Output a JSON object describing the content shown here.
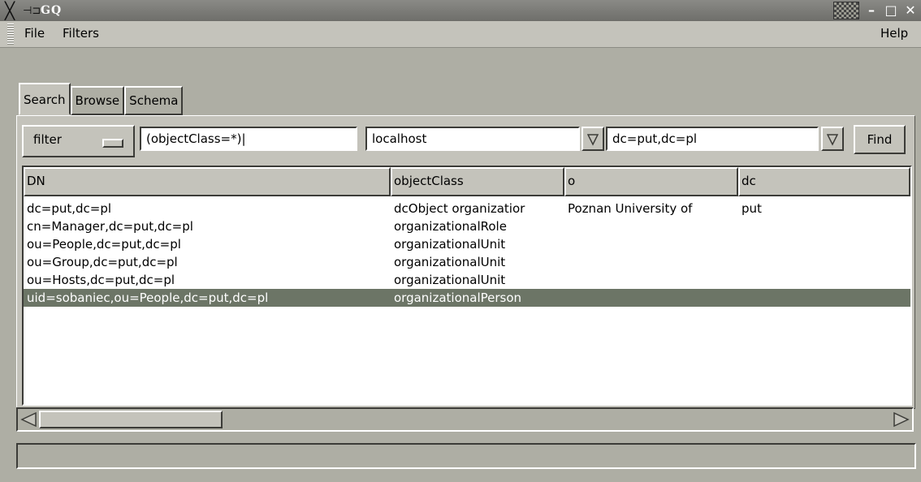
{
  "window": {
    "title": "GQ"
  },
  "menu": {
    "file": "File",
    "filters": "Filters",
    "help": "Help"
  },
  "tabs": [
    {
      "label": "Search",
      "active": true
    },
    {
      "label": "Browse",
      "active": false
    },
    {
      "label": "Schema",
      "active": false
    }
  ],
  "search": {
    "mode": "filter",
    "filter_value": "(objectClass=*)",
    "server": "localhost",
    "base_dn": "dc=put,dc=pl",
    "find_label": "Find"
  },
  "results": {
    "columns": [
      "DN",
      "objectClass",
      "o",
      "dc"
    ],
    "rows": [
      [
        "dc=put,dc=pl",
        "dcObject organizatior",
        "Poznan University of ",
        "put"
      ],
      [
        "cn=Manager,dc=put,dc=pl",
        "organizationalRole",
        "",
        ""
      ],
      [
        "ou=People,dc=put,dc=pl",
        "organizationalUnit",
        "",
        ""
      ],
      [
        "ou=Group,dc=put,dc=pl",
        "organizationalUnit",
        "",
        ""
      ],
      [
        "ou=Hosts,dc=put,dc=pl",
        "organizationalUnit",
        "",
        ""
      ],
      [
        "uid=sobaniec,ou=People,dc=put,dc=pl",
        "organizationalPerson",
        "",
        ""
      ]
    ],
    "selected_row": 5
  },
  "status": {
    "text": ""
  },
  "colors": {
    "selection": "#6c7566",
    "background": "#c4c3bb"
  }
}
